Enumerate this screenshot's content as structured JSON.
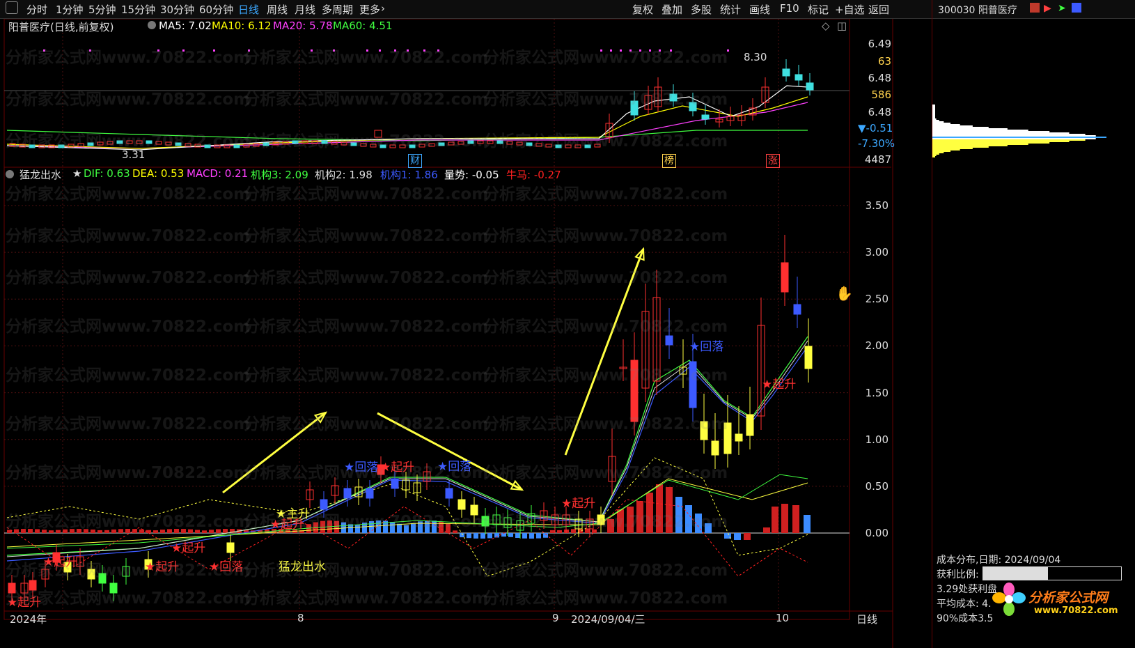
{
  "toolbar": {
    "left_items": [
      "分时",
      "1分钟",
      "5分钟",
      "15分钟",
      "30分钟",
      "60分钟",
      "日线",
      "周线",
      "月线",
      "多周期",
      "更多"
    ],
    "active": "日线",
    "right_items": [
      "复权",
      "叠加",
      "多股",
      "统计",
      "画线",
      "F10",
      "标记",
      "+自选",
      "返回"
    ]
  },
  "security": {
    "code_name": "300030 阳普医疗"
  },
  "main_panel": {
    "title": "阳普医疗(日线,前复权)",
    "ma_labels": [
      {
        "text": "MA5: 7.02",
        "color": "#ffffff"
      },
      {
        "text": "MA10: 6.12",
        "color": "#ffff00"
      },
      {
        "text": "MA20: 5.78",
        "color": "#ff40ff"
      },
      {
        "text": "MA60: 4.51",
        "color": "#40ff40"
      }
    ],
    "high_label": "8.30",
    "low_label": "3.31",
    "badges": [
      {
        "text": "财",
        "color": "#3ca8ff"
      },
      {
        "text": "榜",
        "color": "#ffd24d"
      },
      {
        "text": "涨",
        "color": "#ff4040"
      }
    ],
    "axis": [
      {
        "text": "6.49",
        "color": "#ddd"
      },
      {
        "text": "63",
        "color": "#ffd24d"
      },
      {
        "text": "6.48",
        "color": "#ddd"
      },
      {
        "text": "586",
        "color": "#ffd24d"
      },
      {
        "text": "6.48",
        "color": "#ddd"
      },
      {
        "text": "▼-0.51",
        "color": "#3ca8ff"
      },
      {
        "text": "-7.30%",
        "color": "#3ca8ff"
      },
      {
        "text": "4487",
        "color": "#ddd"
      }
    ]
  },
  "indicator_panel": {
    "title": "猛龙出水",
    "values": [
      {
        "text": "DIF: 0.63",
        "color": "#40ff40"
      },
      {
        "text": "DEA: 0.53",
        "color": "#ffff00"
      },
      {
        "text": "MACD: 0.21",
        "color": "#ff40ff"
      },
      {
        "text": "机构3: 2.09",
        "color": "#40ff40"
      },
      {
        "text": "机构2: 1.98",
        "color": "#dddddd"
      },
      {
        "text": "机构1: 1.86",
        "color": "#3c5aff"
      },
      {
        "text": "量势: -0.05",
        "color": "#ffffff"
      },
      {
        "text": "牛马: -0.27",
        "color": "#ff2020"
      }
    ],
    "axis": [
      "3.50",
      "3.00",
      "2.50",
      "2.00",
      "1.50",
      "1.00",
      "0.50",
      "0.00"
    ],
    "signals": [
      {
        "text": "★回落",
        "color": "#3c5aff"
      },
      {
        "text": "★起升",
        "color": "#ff3030"
      },
      {
        "text": "★回落",
        "color": "#3c5aff"
      },
      {
        "text": "★起升",
        "color": "#ff3030"
      },
      {
        "text": "★回落",
        "color": "#3c5aff"
      },
      {
        "text": "★起升",
        "color": "#ff3030"
      },
      {
        "text": "★主升",
        "color": "#ffff40"
      },
      {
        "text": "★起升",
        "color": "#ff3030"
      },
      {
        "text": "★起升",
        "color": "#ff3030"
      },
      {
        "text": "★起升",
        "color": "#ff3030"
      },
      {
        "text": "★起升",
        "color": "#ff3030"
      },
      {
        "text": "★回落",
        "color": "#ff3030"
      },
      {
        "text": "★起升",
        "color": "#ff3030"
      }
    ],
    "main_label": "猛龙出水"
  },
  "date_axis": [
    "2024年",
    "8",
    "9",
    "2024/09/04/三",
    "10",
    "日线"
  ],
  "cost_distribution": {
    "title": "成本分布,日期: 2024/09/04",
    "profit_ratio_label": "获利比例:",
    "profit_ratio_value": "46.8%",
    "profit_ratio": 0.468,
    "line2": "3.29处获利盘",
    "line3": "平均成本: 4.",
    "line4": "90%成本3.5"
  },
  "watermark": "分析家公式网www.70822.com",
  "logo": {
    "text": "分析家公式网",
    "url": "www.70822.com"
  }
}
